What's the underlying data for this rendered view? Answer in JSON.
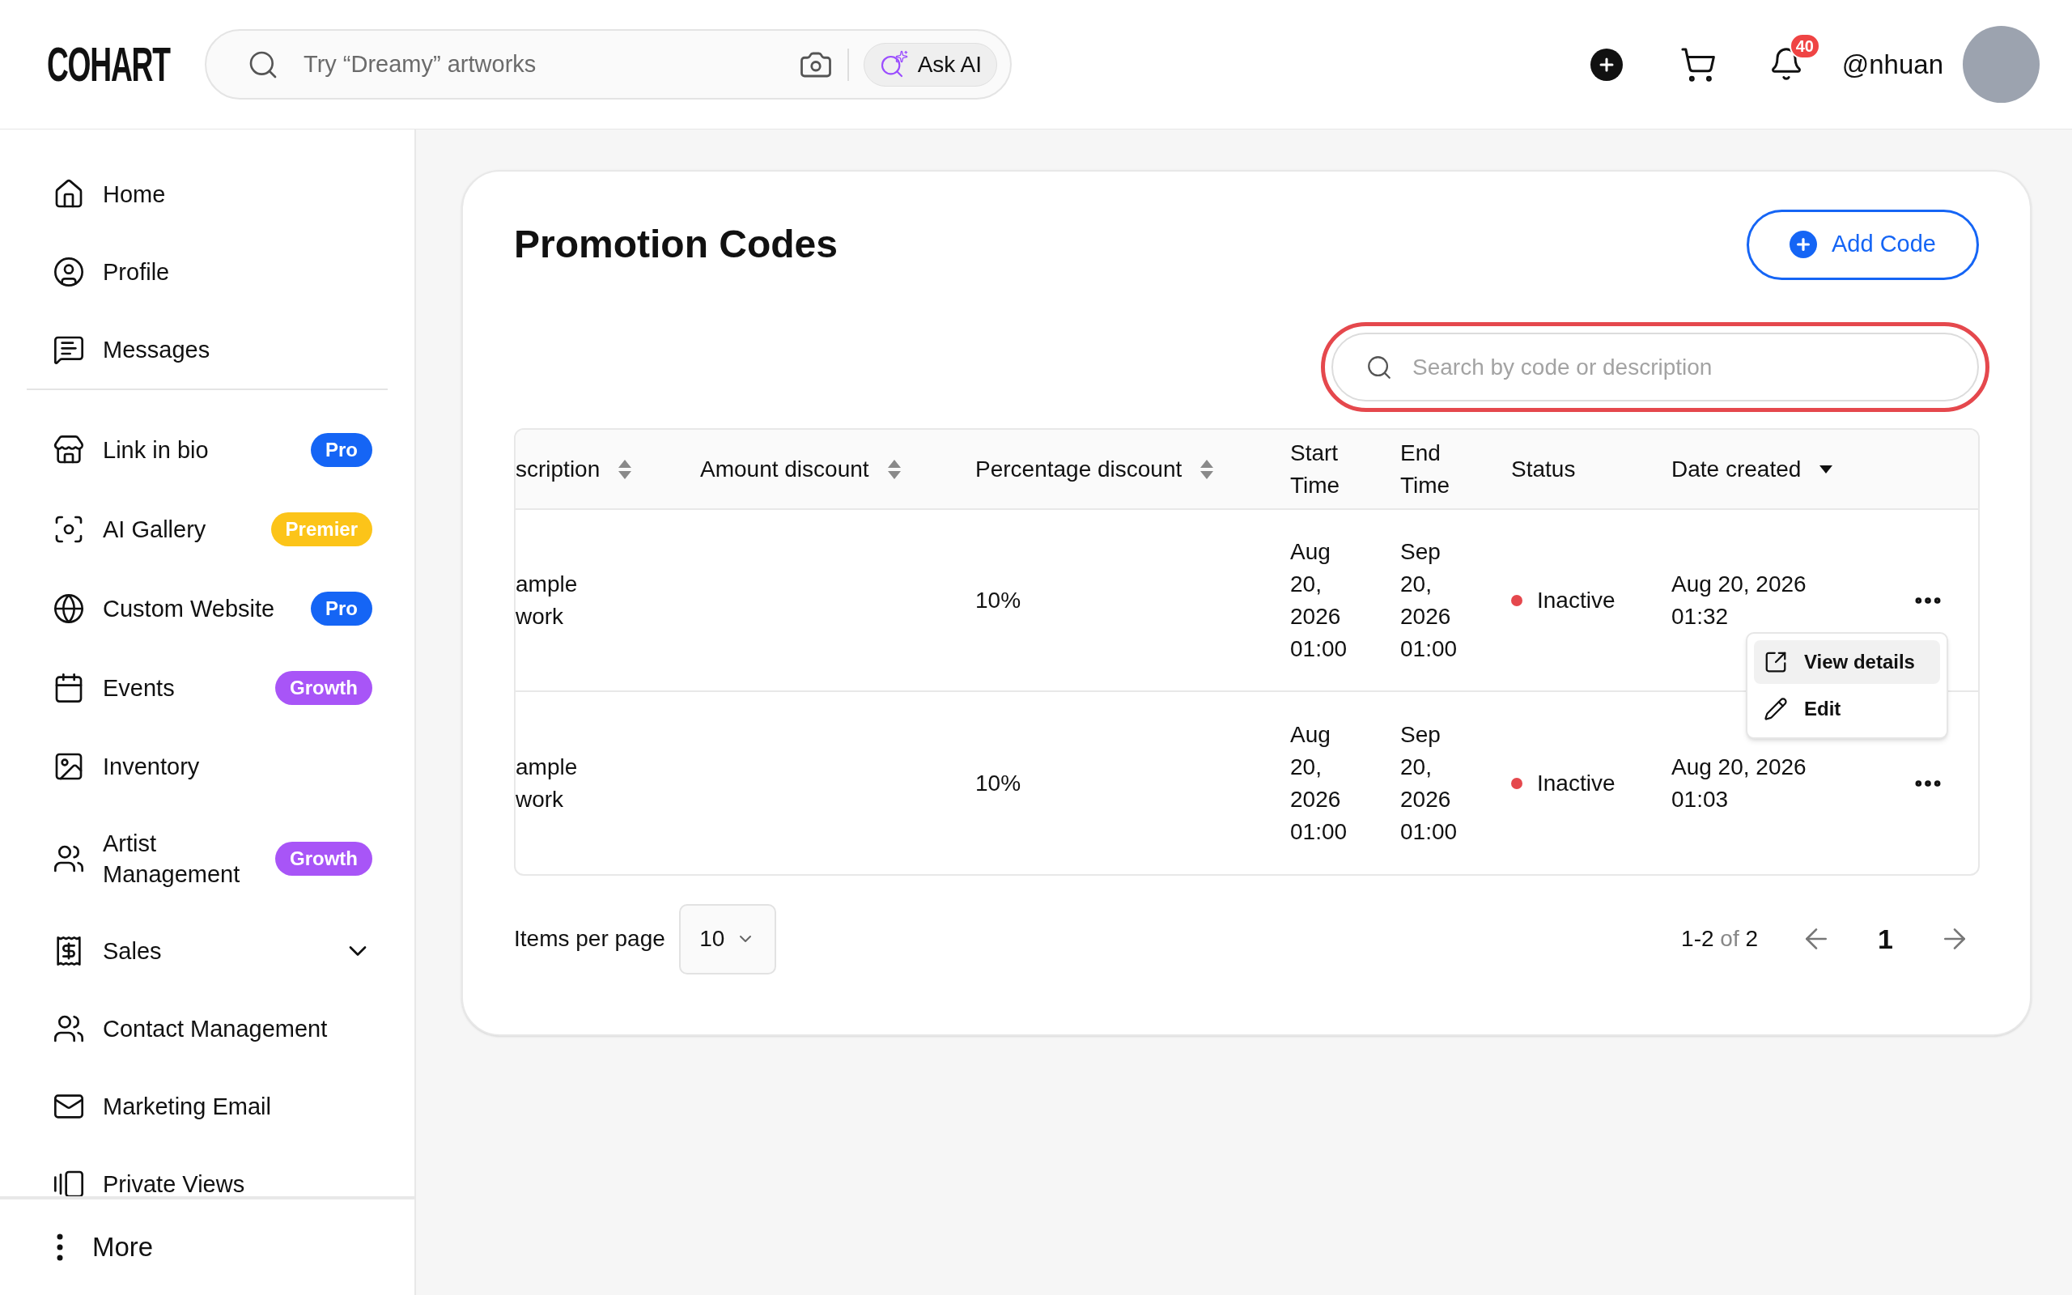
{
  "header": {
    "logo": "COHART",
    "search_placeholder": "Try “Dreamy” artworks",
    "ask_ai": "Ask AI",
    "notification_count": "40",
    "username": "@nhuan"
  },
  "sidebar": {
    "top_items": [
      {
        "label": "Home"
      },
      {
        "label": "Profile"
      },
      {
        "label": "Messages"
      }
    ],
    "items": [
      {
        "label": "Link in bio",
        "badge": {
          "label": "Pro",
          "color": "#1565f5"
        }
      },
      {
        "label": "AI Gallery",
        "badge": {
          "label": "Premier",
          "color": "#fcc419"
        }
      },
      {
        "label": "Custom Website",
        "badge": {
          "label": "Pro",
          "color": "#1565f5"
        }
      },
      {
        "label": "Events",
        "badge": {
          "label": "Growth",
          "color": "#a855f7"
        }
      },
      {
        "label": "Inventory"
      },
      {
        "label": "Artist Management",
        "badge": {
          "label": "Growth",
          "color": "#a855f7"
        }
      },
      {
        "label": "Sales",
        "expanded": false
      },
      {
        "label": "Contact Management"
      },
      {
        "label": "Marketing Email"
      },
      {
        "label": "Private Views"
      }
    ],
    "more": "More"
  },
  "page": {
    "title": "Promotion Codes",
    "add_button": "Add Code",
    "search": {
      "placeholder": "Search by code or description",
      "focused": true
    }
  },
  "table": {
    "columns": [
      {
        "label": "scription",
        "sortable": true,
        "sorted": false
      },
      {
        "label": "Amount discount",
        "sortable": true,
        "sorted": false
      },
      {
        "label": "Percentage discount",
        "sortable": true,
        "sorted": false
      },
      {
        "label": "Start Time"
      },
      {
        "label": "End Time"
      },
      {
        "label": "Status"
      },
      {
        "label": "Date created",
        "sortable": true,
        "sorted": true
      }
    ],
    "rows": [
      {
        "description": "ample work",
        "percentage": "10%",
        "start": "Aug 20, 2026 01:00",
        "end": "Sep 20, 2026 01:00",
        "status": "Inactive",
        "color": "#e5484d",
        "created": "Aug 20, 2026 01:32"
      },
      {
        "description": "ample work",
        "percentage": "10%",
        "start": "Aug 20, 2026 01:00",
        "end": "Sep 20, 2026 01:00",
        "status": "Inactive",
        "color": "#e5484d",
        "created": "Aug 20, 2026 01:03"
      }
    ],
    "menu": [
      {
        "label": "View details",
        "selected": true
      },
      {
        "label": "Edit",
        "selected": false
      }
    ]
  },
  "pagination": {
    "items_per_page": "Items per page",
    "per_page": "10",
    "range": "1-2",
    "of": "of",
    "total": "2",
    "page": "1"
  }
}
